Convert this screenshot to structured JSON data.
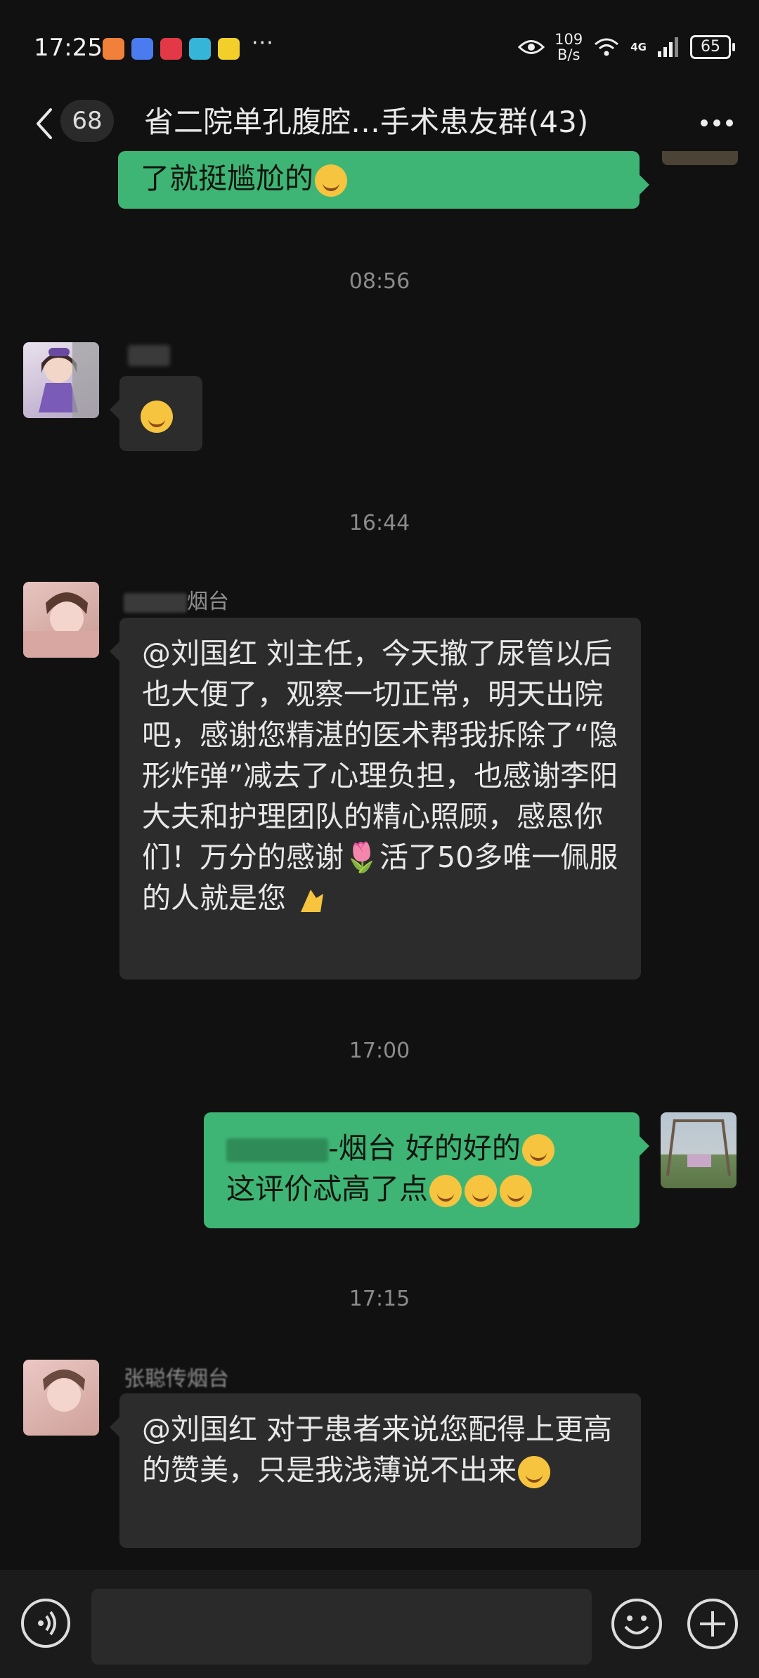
{
  "status_bar": {
    "time": "17:25",
    "more": "···",
    "net_speed_value": "109",
    "net_speed_unit": "B/s",
    "network": "4G",
    "battery": "65"
  },
  "nav": {
    "unread_count": "68",
    "title": "省二院单孔腹腔…手术患友群(43)"
  },
  "messages": [
    {
      "type": "outgoing_partial",
      "text": "了就挺尴尬的"
    },
    {
      "type": "time",
      "text": "08:56"
    },
    {
      "type": "incoming",
      "sender": "",
      "text": ""
    },
    {
      "type": "time",
      "text": "16:44"
    },
    {
      "type": "incoming",
      "sender": "烟台",
      "text": "@刘国红  刘主任，今天撤了尿管以后也大便了，观察一切正常，明天出院吧，感谢您精湛的医术帮我拆除了“隐形炸弹”减去了心理负担，也感谢李阳大夫和护理团队的精心照顾，感恩你们！万分的感谢🌷活了50多唯一佩服的人就是您"
    },
    {
      "type": "time",
      "text": "17:00"
    },
    {
      "type": "outgoing",
      "text_line1": "-烟台  好的好的",
      "text_line2": "这评价忒高了点"
    },
    {
      "type": "time",
      "text": "17:15"
    },
    {
      "type": "incoming",
      "sender": "张聪传烟台",
      "text": "@刘国红  对于患者来说您配得上更高的赞美，只是我浅薄说不出来"
    }
  ],
  "colors": {
    "background": "#111111",
    "incoming_bubble": "#2c2c2c",
    "outgoing_bubble": "#3eb574",
    "timestamp": "#8b8b8b"
  },
  "icons": {
    "back": "chevron-left-icon",
    "menu": "more-horizontal-icon",
    "voice": "voice-icon",
    "emoji": "emoji-icon",
    "plus": "plus-icon"
  }
}
